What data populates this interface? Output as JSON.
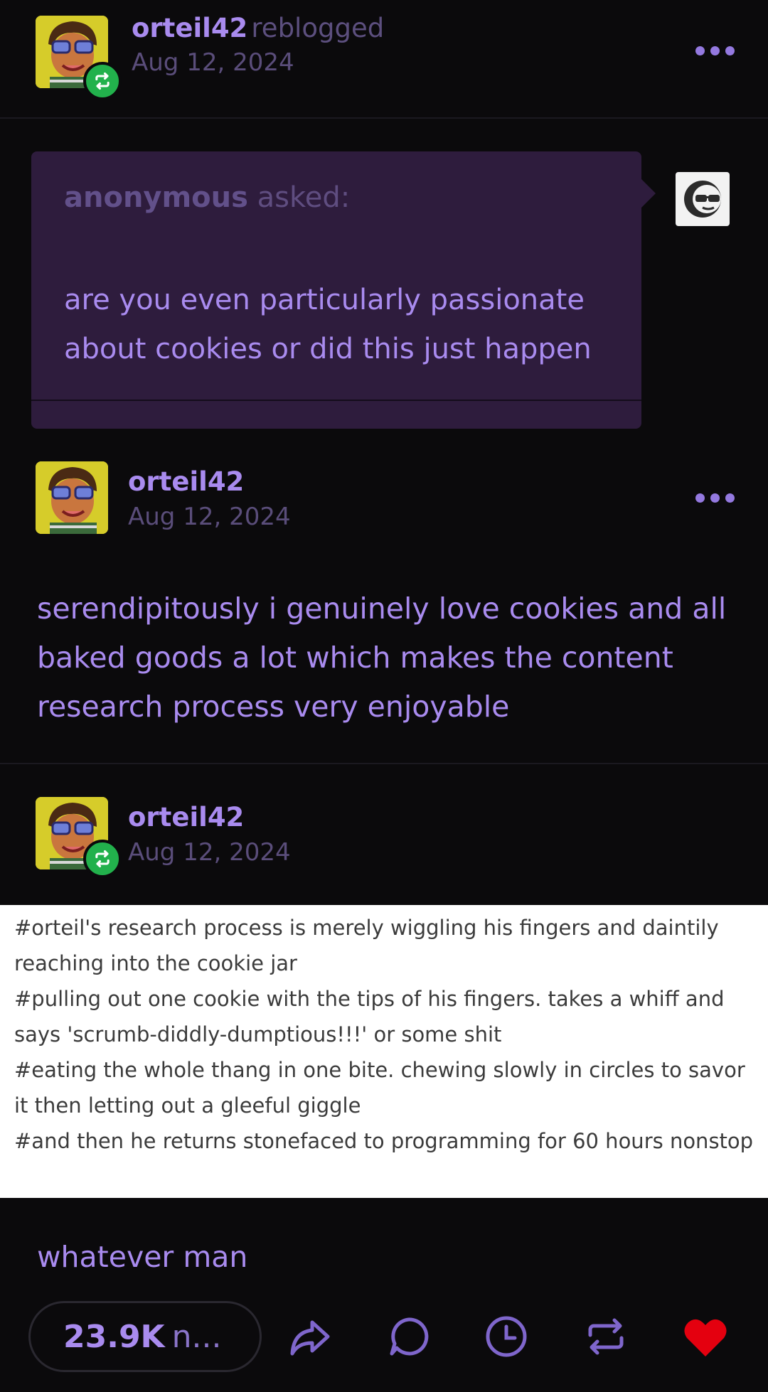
{
  "reblog_header": {
    "username": "orteil42",
    "action_text": "reblogged",
    "date": "Aug 12, 2024"
  },
  "ask": {
    "asker": "anonymous",
    "asked_label": "asked:",
    "question": "are you even particularly passionate about cookies or did this just happen"
  },
  "answer_post": {
    "username": "orteil42",
    "date": "Aug 12, 2024",
    "body": "serendipitously i genuinely love cookies and all baked goods a lot which makes the content research process very enjoyable"
  },
  "reblog_post": {
    "username": "orteil42",
    "date": "Aug 12, 2024",
    "tags": [
      "#orteil's research process is merely wiggling his fingers and daintily reaching into the cookie jar",
      "#pulling out one cookie with the tips of his fingers. takes a whiff and says 'scrumb-diddly-dumptious!!!' or some shit",
      "#eating the whole thang in one bite. chewing slowly in circles to savor it then letting out a gleeful giggle",
      "#and then he returns stonefaced to programming for 60 hours nonstop"
    ],
    "body": "whatever man"
  },
  "footer": {
    "notes_count": "23.9K",
    "notes_suffix": "n...",
    "icons": [
      "share-icon",
      "reply-icon",
      "queue-icon",
      "reblog-icon",
      "like-icon"
    ]
  },
  "colors": {
    "background": "#0b0a0c",
    "accent": "#a98bef",
    "ask_bg": "#2e1c3d",
    "reblog_badge": "#22b14c",
    "like": "#e4000f"
  }
}
